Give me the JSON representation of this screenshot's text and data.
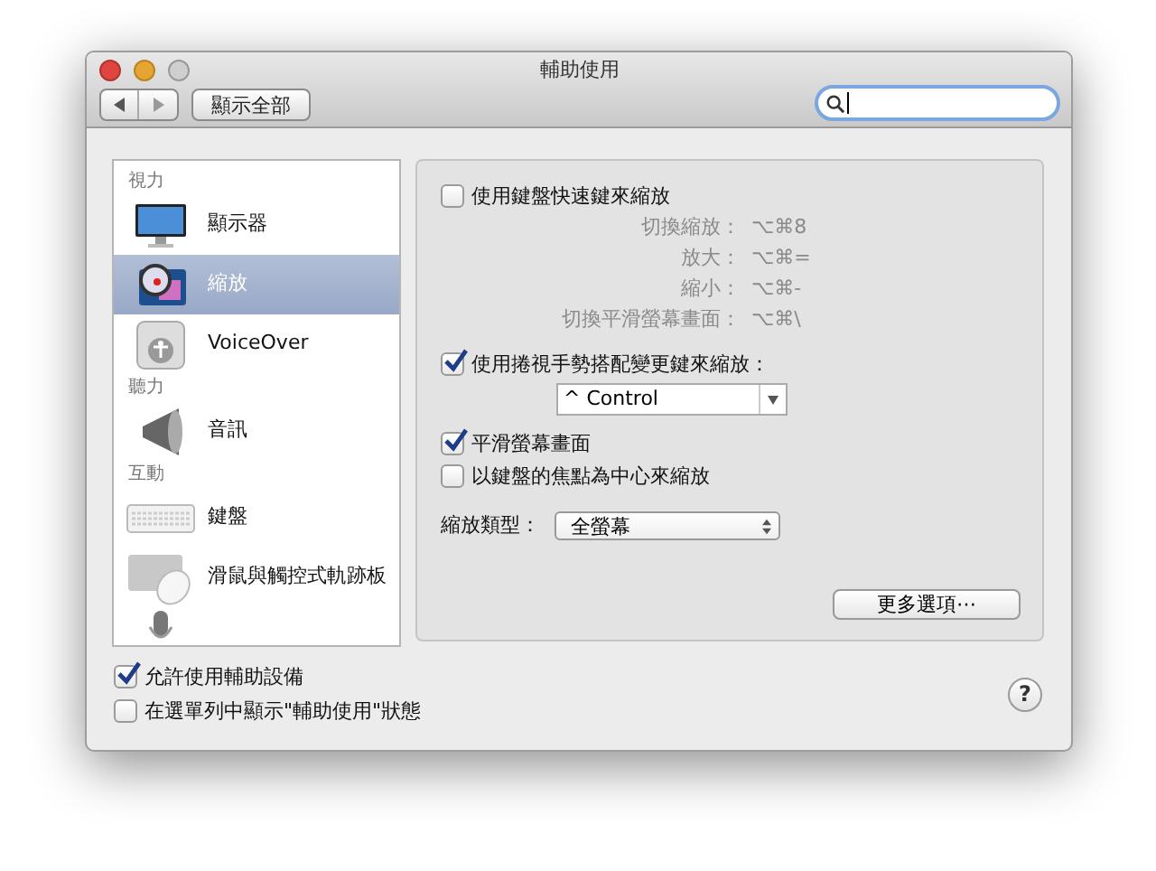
{
  "window": {
    "title": "輔助使用"
  },
  "toolbar": {
    "show_all": "顯示全部"
  },
  "sidebar": {
    "items": [
      {
        "kind": "header",
        "label": "視力"
      },
      {
        "kind": "item",
        "label": "顯示器",
        "selected": false
      },
      {
        "kind": "item",
        "label": "縮放",
        "selected": true
      },
      {
        "kind": "item",
        "label": "VoiceOver",
        "selected": false
      },
      {
        "kind": "header",
        "label": "聽力"
      },
      {
        "kind": "item",
        "label": "音訊",
        "selected": false
      },
      {
        "kind": "header",
        "label": "互動"
      },
      {
        "kind": "item",
        "label": "鍵盤",
        "selected": false
      },
      {
        "kind": "item",
        "label": "滑鼠與觸控式軌跡板",
        "selected": false
      }
    ]
  },
  "zoom_panel": {
    "keyboard_shortcuts": {
      "label": "使用鍵盤快速鍵來縮放",
      "checked": false
    },
    "shortcuts": [
      {
        "label": "切換縮放：",
        "keys": "⌥⌘8"
      },
      {
        "label": "放大：",
        "keys": "⌥⌘="
      },
      {
        "label": "縮小：",
        "keys": "⌥⌘-"
      },
      {
        "label": "切換平滑螢幕畫面：",
        "keys": "⌥⌘\\"
      }
    ],
    "scroll_gesture": {
      "label": "使用捲視手勢搭配變更鍵來縮放：",
      "checked": true,
      "modifier": "^ Control"
    },
    "smooth_images": {
      "label": "平滑螢幕畫面",
      "checked": true
    },
    "follow_focus": {
      "label": "以鍵盤的焦點為中心來縮放",
      "checked": false
    },
    "zoom_style": {
      "label": "縮放類型：",
      "value": "全螢幕"
    },
    "more_options": "更多選項⋯"
  },
  "footer": {
    "checkboxes": [
      {
        "label": "允許使用輔助設備",
        "checked": true
      },
      {
        "label": "在選單列中顯示\"輔助使用\"狀態",
        "checked": false
      }
    ],
    "help": "?"
  }
}
